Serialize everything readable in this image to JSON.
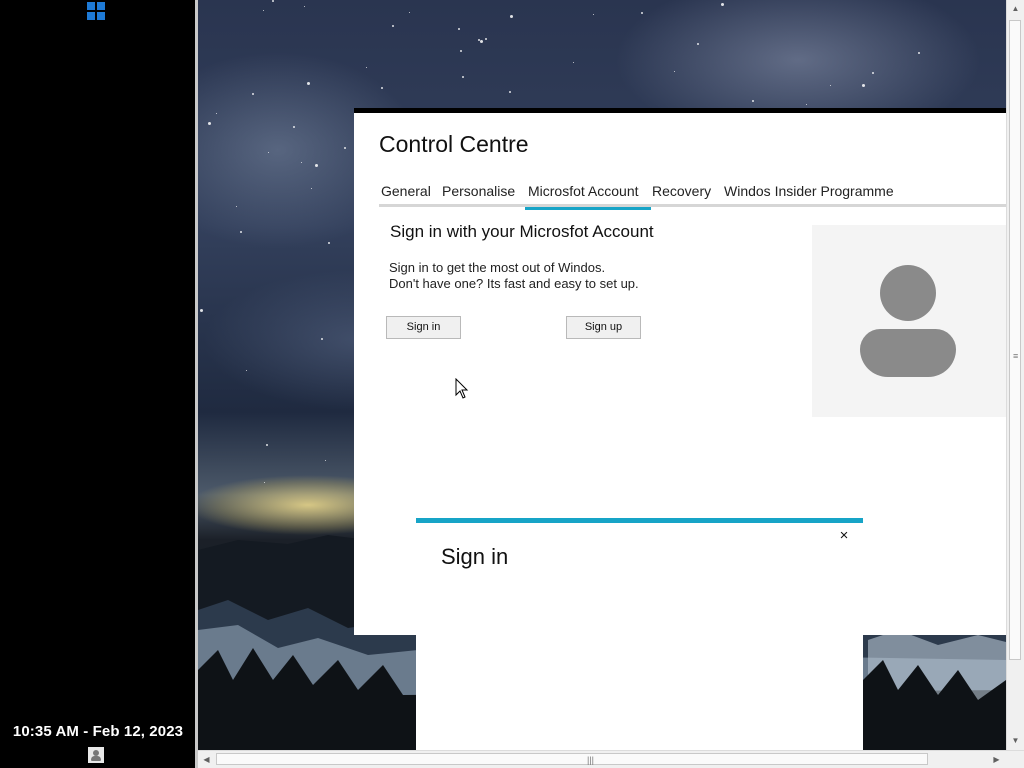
{
  "taskbar": {
    "start_icon": "windows-logo-icon",
    "clock": "10:35 AM - Feb 12, 2023",
    "user_icon": "user-icon",
    "accent_color": "#1e7ad6"
  },
  "control_centre": {
    "title": "Control Centre",
    "tabs": [
      {
        "label": "General",
        "active": false
      },
      {
        "label": "Personalise",
        "active": false
      },
      {
        "label": "Microsfot Account",
        "active": true
      },
      {
        "label": "Recovery",
        "active": false
      },
      {
        "label": "Windos Insider Programme",
        "active": false
      }
    ],
    "account": {
      "heading": "Sign in with your Microsfot Account",
      "desc_line1": "Sign in to get the most out of Windos.",
      "desc_line2": "Don't have one? Its fast and easy to set up.",
      "signin_button": "Sign in",
      "signup_button": "Sign up",
      "avatar_icon": "user-avatar-icon"
    },
    "accent_color": "#17a4c7"
  },
  "signin_dialog": {
    "title": "Sign in",
    "close_label": "×"
  },
  "scrollbars": {
    "vertical_grip": "≡",
    "horizontal_grip": "|||"
  }
}
